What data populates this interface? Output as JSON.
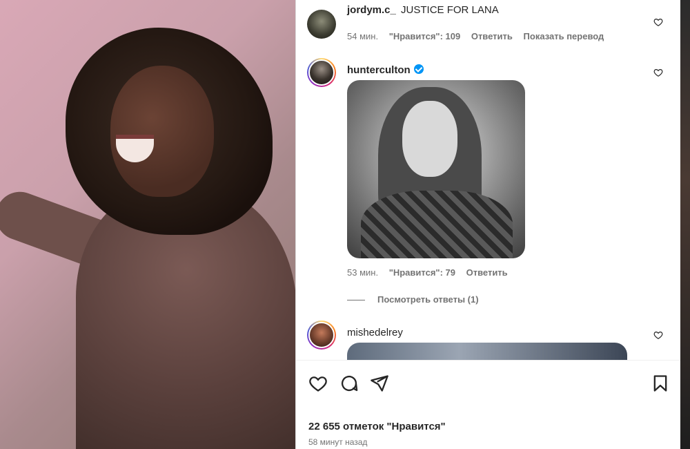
{
  "comments": [
    {
      "username": "jordym.c_",
      "text": "JUSTICE FOR LANA",
      "time": "54 мин.",
      "likes": "\"Нравится\": 109",
      "reply": "Ответить",
      "translate": "Показать перевод"
    },
    {
      "username": "hunterculton",
      "verified": true,
      "time": "53 мин.",
      "likes": "\"Нравится\": 79",
      "reply": "Ответить",
      "view_replies": "Посмотреть ответы (1)"
    },
    {
      "username": "mishedelrey"
    }
  ],
  "post": {
    "likes_count": "22 655 отметок \"Нравится\"",
    "posted_ago": "58 минут назад"
  },
  "icons": {
    "like": "heart-icon",
    "comment": "comment-icon",
    "share": "share-icon",
    "save": "bookmark-icon"
  },
  "colors": {
    "text": "#262626",
    "secondary": "#737373",
    "verified": "#0095f6"
  }
}
